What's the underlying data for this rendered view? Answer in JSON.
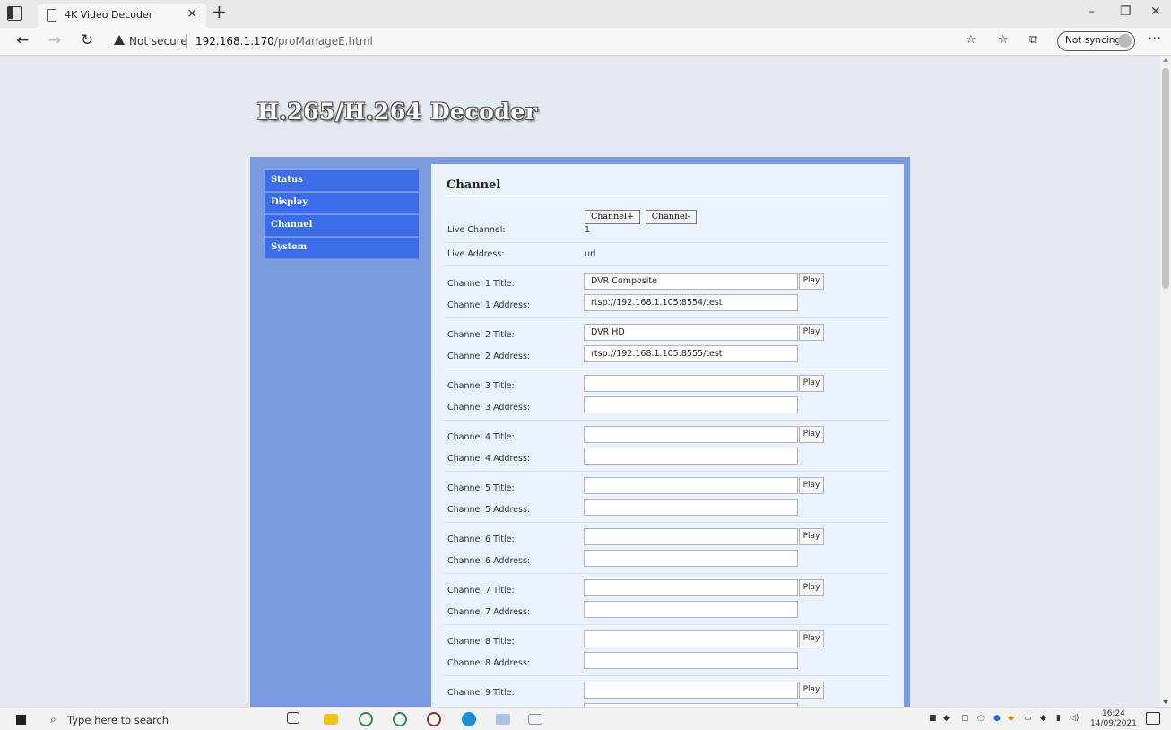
{
  "browser": {
    "tab_title": "4K Video Decoder",
    "tab_close": "×",
    "new_tab": "+",
    "security_label": "Not secure",
    "url_host": "192.168.1.170",
    "url_path": "/proManageE.html",
    "sync_label": "Not syncing",
    "minimize": "–",
    "restore": "❐",
    "close": "✕",
    "back": "←",
    "forward": "→",
    "refresh": "↻",
    "more": "···"
  },
  "page": {
    "title": "H.265/H.264 Decoder"
  },
  "nav": {
    "items": [
      {
        "label": "Status"
      },
      {
        "label": "Display"
      },
      {
        "label": "Channel"
      },
      {
        "label": "System"
      }
    ]
  },
  "channel": {
    "heading": "Channel",
    "btn_next": "Channel+",
    "btn_prev": "Channel-",
    "live_channel_label": "Live Channel:",
    "live_channel_value": "1",
    "live_address_label": "Live Address:",
    "live_address_value": "url",
    "play_label": "Play",
    "channels": [
      {
        "title_label": "Channel 1 Title:",
        "address_label": "Channel 1 Address:",
        "title": "DVR Composite",
        "address": "rtsp://192.168.1.105:8554/test"
      },
      {
        "title_label": "Channel 2 Title:",
        "address_label": "Channel 2 Address:",
        "title": "DVR HD",
        "address": "rtsp://192.168.1.105:8555/test"
      },
      {
        "title_label": "Channel 3 Title:",
        "address_label": "Channel 3 Address:",
        "title": "",
        "address": ""
      },
      {
        "title_label": "Channel 4 Title:",
        "address_label": "Channel 4 Address:",
        "title": "",
        "address": ""
      },
      {
        "title_label": "Channel 5 Title:",
        "address_label": "Channel 5 Address:",
        "title": "",
        "address": ""
      },
      {
        "title_label": "Channel 6 Title:",
        "address_label": "Channel 6 Address:",
        "title": "",
        "address": ""
      },
      {
        "title_label": "Channel 7 Title:",
        "address_label": "Channel 7 Address:",
        "title": "",
        "address": ""
      },
      {
        "title_label": "Channel 8 Title:",
        "address_label": "Channel 8 Address:",
        "title": "",
        "address": ""
      },
      {
        "title_label": "Channel 9 Title:",
        "address_label": "",
        "title": "",
        "address": ""
      }
    ]
  },
  "taskbar": {
    "search_placeholder": "Type here to search",
    "time": "16:24",
    "date": "14/09/2021"
  }
}
